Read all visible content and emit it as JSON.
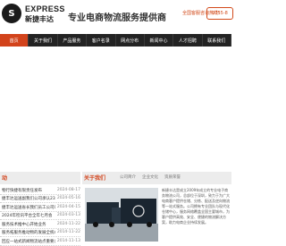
{
  "header": {
    "logo_mark": "S",
    "brand_en": "EXPRESS",
    "brand_cn": "新捷丰达",
    "slogan": "专业电商物流服务提供商",
    "hotline_label": "全国客服咨询热线：",
    "phone": "0755-8"
  },
  "nav": {
    "items": [
      "首页",
      "关于我们",
      "产品服务",
      "客户名录",
      "网点分布",
      "新闻中心",
      "人才招聘",
      "联系我们"
    ],
    "active_index": 0
  },
  "colors": {
    "accent": "#d2431b",
    "nav_bg": "#232323"
  },
  "news": {
    "title": "动",
    "items": [
      {
        "title": "物行快捷有限责任发布",
        "date": "2024-08-17"
      },
      {
        "title": "捷丰达运送副我们公司承认23.5%",
        "date": "2024-05-16"
      },
      {
        "title": "捷丰达运送省长我们员工公司0064到",
        "date": "2024-04-15"
      },
      {
        "title": "2024年检讯平台全年七月会",
        "date": "2024-03-13"
      },
      {
        "title": "服务技术推中心开始业务",
        "date": "2024-11-22"
      },
      {
        "title": "服务拓服务推动物的发展全统本客户",
        "date": "2014-11-22"
      },
      {
        "title": "回应一站式新闻物流站点重要公告",
        "date": "2014-11-13"
      }
    ]
  },
  "about": {
    "title": "关于我们",
    "tabs": [
      "公司简介",
      "企业文化",
      "资质荣誉"
    ],
    "text": "新捷丰达是成立2009年成立的专业电子商务物流公司，总部位于深圳，致力于为广大电商客户提供仓储、分拣、配送及逆向物流等一站式服务。公司拥有专业团队与现代化仓储中心，服务网络覆盖全国主要城市，为客户提供高效、安全、便捷的物流解决方案，助力电商企业持续发展。"
  }
}
